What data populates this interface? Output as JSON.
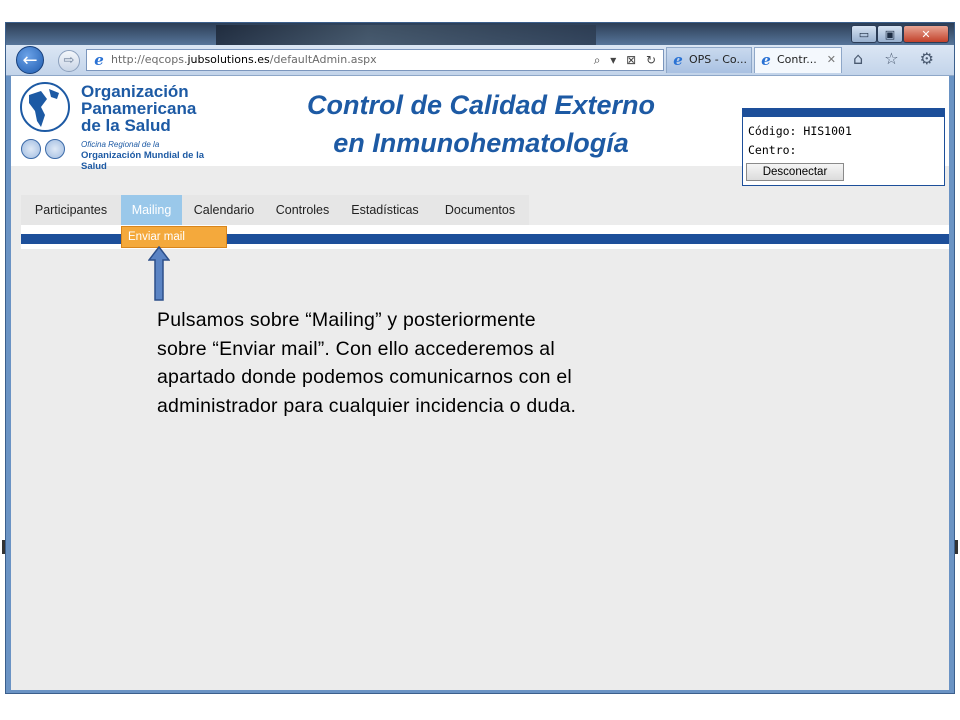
{
  "browser": {
    "address_prefix": "http://eqcops.",
    "address_domain": "jubsolutions.es",
    "address_path": "/defaultAdmin.aspx",
    "address_tools": "⌕ ▾ ⊠ ↻",
    "back_glyph": "←",
    "forward_glyph": "⇨",
    "ie_glyph": "e",
    "tabs": [
      {
        "label": "OPS - Co..."
      },
      {
        "label": "Contr...",
        "close": "✕"
      }
    ],
    "tool_icons": "⌂ ☆ ⚙",
    "window_buttons": {
      "minimize": "▭",
      "maximize": "▣",
      "close": "✕"
    }
  },
  "header": {
    "logo": {
      "line1": "Organización",
      "line2": "Panamericana",
      "line3": "de la Salud",
      "small": "Oficina Regional de la",
      "who": "Organización Mundial de la Salud"
    },
    "title_line1": "Control de Calidad Externo",
    "title_line2": "en Inmunohematología"
  },
  "login": {
    "codigo_label": "Código:",
    "codigo_value": "HIS1001",
    "centro_label": "Centro:",
    "disconnect_label": "Desconectar"
  },
  "menu": {
    "items": [
      {
        "label": "Participantes"
      },
      {
        "label": "Mailing"
      },
      {
        "label": "Calendario"
      },
      {
        "label": "Controles"
      },
      {
        "label": "Estadísticas"
      },
      {
        "label": "Documentos"
      }
    ],
    "submenu_item": "Enviar mail"
  },
  "annotation": {
    "line1": "Pulsamos sobre “Mailing” y posteriormente",
    "line2": "sobre “Enviar mail”. Con ello accederemos al",
    "line3": "apartado donde podemos comunicarnos con el",
    "line4": "administrador para cualquier incidencia o duda."
  },
  "colors": {
    "brand_blue": "#1d5aa4",
    "stripe_blue": "#1d4f9a",
    "menu_active": "#9ac8ea",
    "submenu_orange": "#f4a93c",
    "arrow_fill": "#5b84c4"
  }
}
